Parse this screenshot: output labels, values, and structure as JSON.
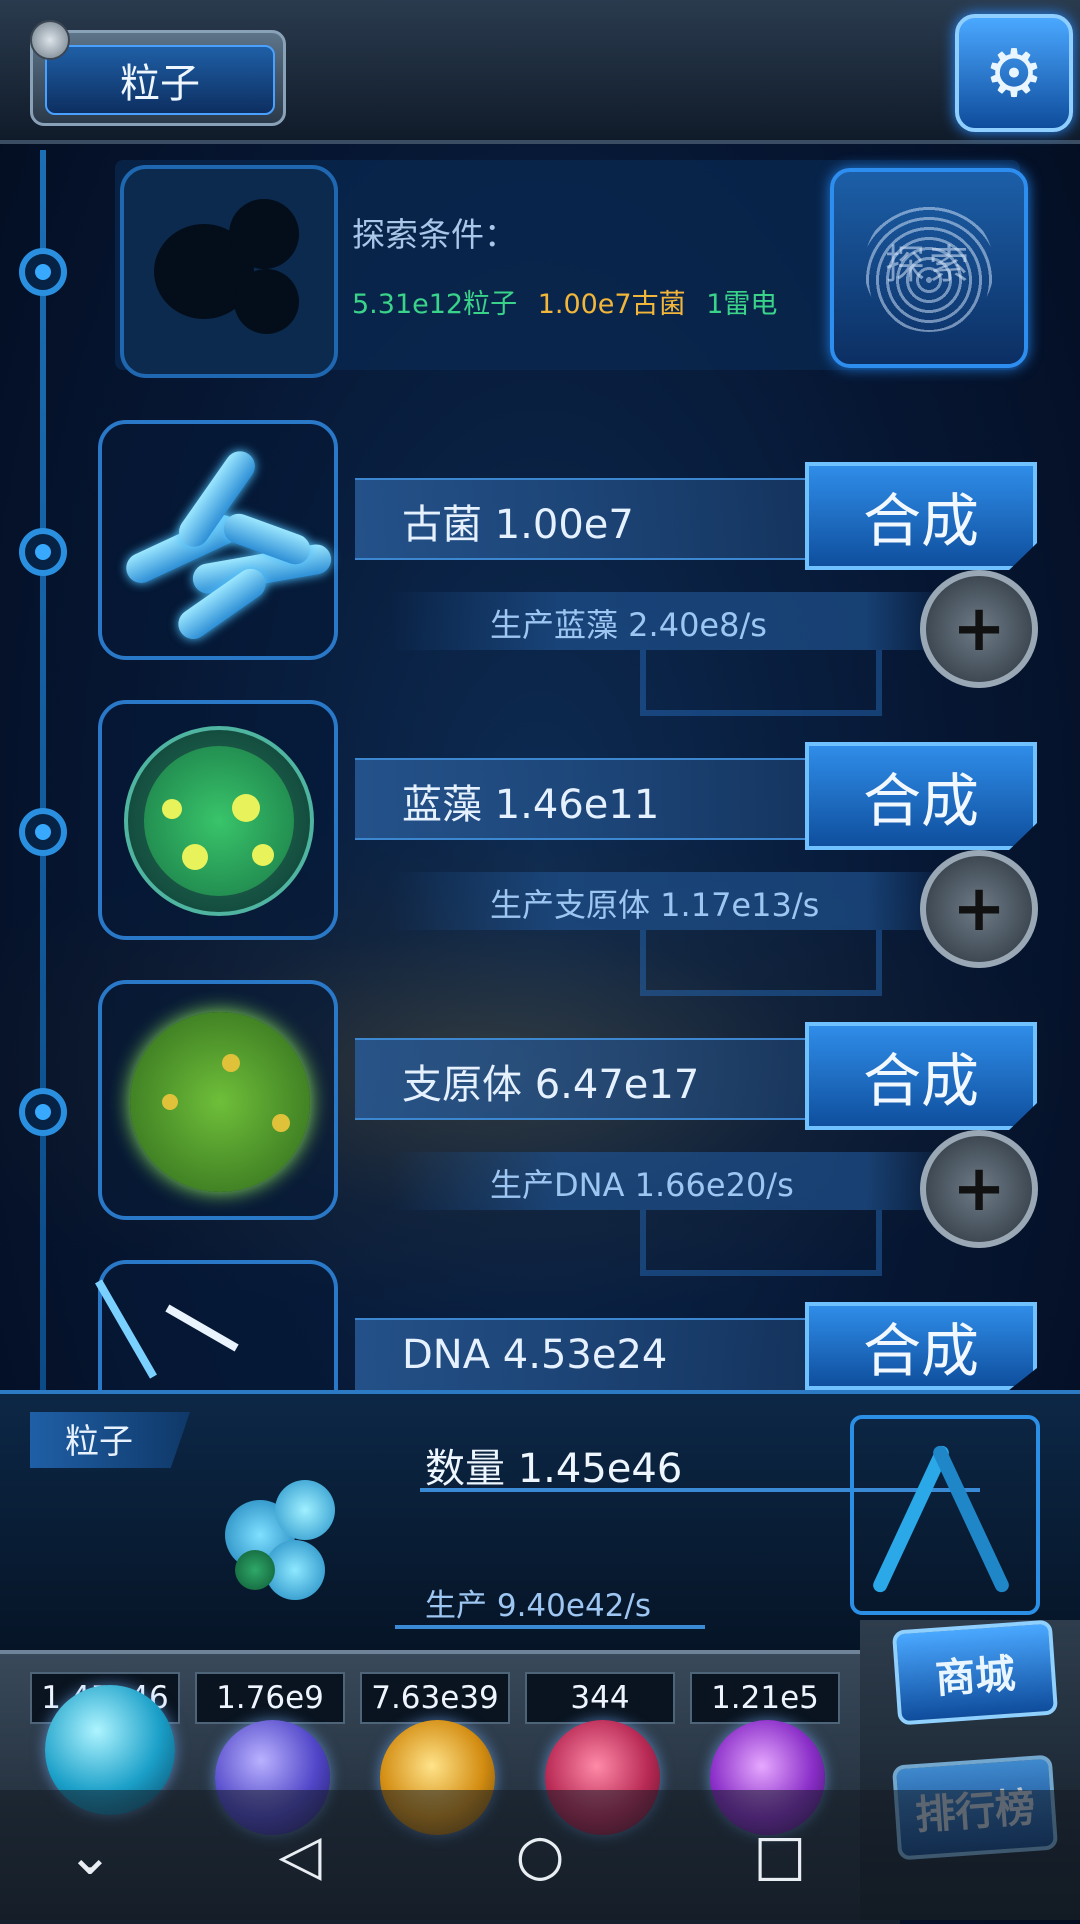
{
  "header": {
    "title": "粒子",
    "settings_icon": "gear-icon"
  },
  "explore": {
    "condition_label": "探索条件：",
    "requirements": [
      {
        "text": "5.31e12粒子",
        "color": "#39d38a"
      },
      {
        "text": "1.00e7古菌",
        "color": "#f2b63a"
      },
      {
        "text": "1雷电",
        "color": "#39d38a"
      }
    ],
    "button_label": "探索",
    "button_icon": "fingerprint-icon"
  },
  "items": [
    {
      "name": "古菌 1.00e7",
      "production": "生产蓝藻 2.40e8/s",
      "synth_label": "合成",
      "image": "archaea-icon"
    },
    {
      "name": "蓝藻 1.46e11",
      "production": "生产支原体 1.17e13/s",
      "synth_label": "合成",
      "image": "cyanobacteria-icon"
    },
    {
      "name": "支原体 6.47e17",
      "production": "生产DNA 1.66e20/s",
      "synth_label": "合成",
      "image": "mycoplasma-icon"
    },
    {
      "name": "DNA 4.53e24",
      "synth_label": "合成",
      "image": "dna-icon"
    }
  ],
  "particle_panel": {
    "tag": "粒子",
    "count": "数量 1.45e46",
    "production": "生产 9.40e42/s"
  },
  "resources": [
    {
      "value": "1.45e46",
      "orb": "particle-orb",
      "color": "#33c6e6"
    },
    {
      "value": "1.76e9",
      "orb": "lightning-orb",
      "color": "#6a5bd6"
    },
    {
      "value": "7.63e39",
      "orb": "explosion-orb",
      "color": "#d99a1a"
    },
    {
      "value": "344",
      "orb": "brain-orb",
      "color": "#c2305c"
    },
    {
      "value": "1.21e5",
      "orb": "vortex-orb",
      "color": "#8c3ac8"
    }
  ],
  "side_buttons": {
    "shop": "商城",
    "ranking": "排行榜"
  },
  "nav": {
    "back": "◁",
    "home": "○",
    "recents": "□",
    "down": "⌄"
  }
}
